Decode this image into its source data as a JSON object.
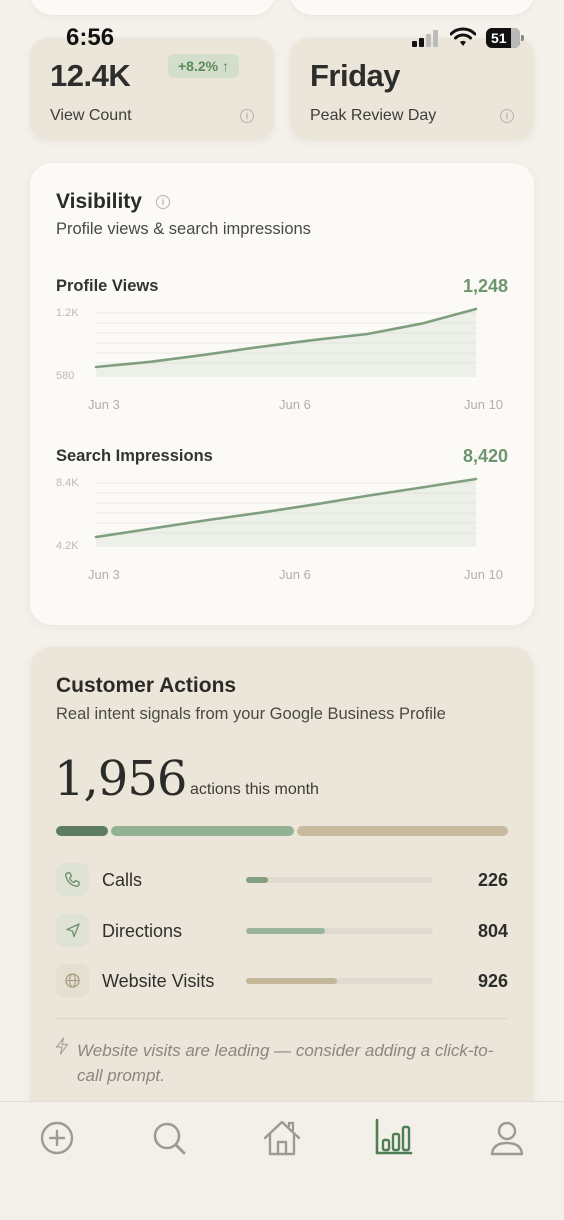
{
  "status_bar": {
    "time": "6:56",
    "battery": "51"
  },
  "stats": {
    "view_count": {
      "value": "12.4K",
      "label": "View Count",
      "badge": "+8.2% ↑"
    },
    "peak_day": {
      "value": "Friday",
      "label": "Peak Review Day"
    }
  },
  "visibility": {
    "title": "Visibility",
    "subtitle": "Profile views & search impressions",
    "profile_views": {
      "label": "Profile Views",
      "value": "1,248",
      "y_max_label": "1.2K",
      "y_min_label": "580",
      "x_labels": [
        "Jun 3",
        "Jun 6",
        "Jun 10"
      ]
    },
    "search_impressions": {
      "label": "Search Impressions",
      "value": "8,420",
      "y_max_label": "8.4K",
      "y_min_label": "4.2K",
      "x_labels": [
        "Jun 3",
        "Jun 6",
        "Jun 10"
      ]
    }
  },
  "chart_data": [
    {
      "type": "area",
      "x": [
        "Jun 3",
        "Jun 4",
        "Jun 5",
        "Jun 6",
        "Jun 7",
        "Jun 8",
        "Jun 9",
        "Jun 10"
      ],
      "values": [
        580,
        640,
        720,
        810,
        890,
        960,
        1080,
        1248
      ],
      "ylim": [
        580,
        1248
      ],
      "color": "#7f9f7f"
    },
    {
      "type": "area",
      "x": [
        "Jun 3",
        "Jun 4",
        "Jun 5",
        "Jun 6",
        "Jun 7",
        "Jun 8",
        "Jun 9",
        "Jun 10"
      ],
      "values": [
        4200,
        4800,
        5400,
        5950,
        6550,
        7200,
        7800,
        8420
      ],
      "ylim": [
        4200,
        8420
      ],
      "color": "#7f9f7f"
    }
  ],
  "actions": {
    "title": "Customer Actions",
    "subtitle": "Real intent signals from your Google Business Profile",
    "total": "1,956",
    "total_caption": "actions this month",
    "max": 956,
    "items": [
      {
        "label": "Calls",
        "count": "226",
        "value": 226,
        "icon": "phone-icon",
        "color": "#7f9f7f"
      },
      {
        "label": "Directions",
        "count": "804",
        "value": 804,
        "icon": "navigation-arrow-icon",
        "color": "#9bb59b"
      },
      {
        "label": "Website Visits",
        "count": "926",
        "value": 926,
        "icon": "globe-icon",
        "color": "#c4b89a"
      }
    ],
    "stack_colors": [
      "#5e7d60",
      "#93b193",
      "#c8bb9d"
    ],
    "tip": "Website visits are leading — consider adding a click-to-call prompt."
  },
  "tab_bar": {
    "items": [
      {
        "icon": "plus-circle-icon",
        "active": false
      },
      {
        "icon": "search-icon",
        "active": false
      },
      {
        "icon": "home-icon",
        "active": false
      },
      {
        "icon": "bar-chart-icon",
        "active": true
      },
      {
        "icon": "profile-icon",
        "active": false
      }
    ]
  }
}
